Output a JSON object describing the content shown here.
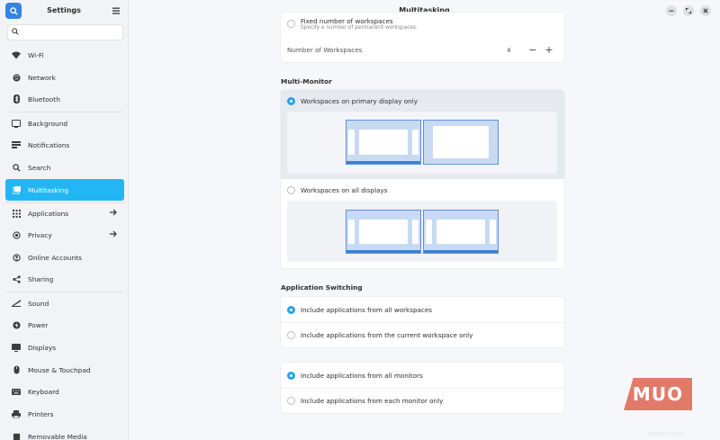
{
  "sidebar": {
    "title": "Settings",
    "search_placeholder": "",
    "items": [
      {
        "label": "Wi-Fi",
        "icon": "wifi-icon"
      },
      {
        "label": "Network",
        "icon": "network-icon"
      },
      {
        "label": "Bluetooth",
        "icon": "bluetooth-icon"
      },
      {
        "label": "Background",
        "icon": "background-icon"
      },
      {
        "label": "Notifications",
        "icon": "notifications-icon"
      },
      {
        "label": "Search",
        "icon": "search-icon"
      },
      {
        "label": "Multitasking",
        "icon": "multitasking-icon",
        "active": true
      },
      {
        "label": "Applications",
        "icon": "applications-icon",
        "arrow": true
      },
      {
        "label": "Privacy",
        "icon": "privacy-icon",
        "arrow": true
      },
      {
        "label": "Online Accounts",
        "icon": "online-accounts-icon"
      },
      {
        "label": "Sharing",
        "icon": "sharing-icon"
      },
      {
        "label": "Sound",
        "icon": "sound-icon"
      },
      {
        "label": "Power",
        "icon": "power-icon"
      },
      {
        "label": "Displays",
        "icon": "displays-icon"
      },
      {
        "label": "Mouse & Touchpad",
        "icon": "mouse-icon"
      },
      {
        "label": "Keyboard",
        "icon": "keyboard-icon"
      },
      {
        "label": "Printers",
        "icon": "printer-icon"
      },
      {
        "label": "Removable Media",
        "icon": "removable-media-icon"
      }
    ]
  },
  "main": {
    "title": "Multitasking",
    "workspaces": {
      "fixed_label": "Fixed number of workspaces",
      "fixed_sub": "Specify a number of permanent workspaces.",
      "count_label": "Number of Workspaces",
      "count_value": "4",
      "minus": "−",
      "plus": "+"
    },
    "multi_monitor": {
      "title": "Multi-Monitor",
      "option_primary": "Workspaces on primary display only",
      "option_all": "Workspaces on all displays",
      "selected": "primary"
    },
    "app_switching": {
      "title": "Application Switching",
      "group1": [
        {
          "label": "Include applications from all workspaces",
          "selected": true
        },
        {
          "label": "Include applications from the current workspace only",
          "selected": false
        }
      ],
      "group2": [
        {
          "label": "Include applications from all monitors",
          "selected": true
        },
        {
          "label": "Include applications from each monitor only",
          "selected": false
        }
      ]
    }
  },
  "watermark": {
    "logo": "MUO",
    "site": "wsxdn.com"
  },
  "colors": {
    "accent": "#22b7f4",
    "radio_selected": "#27a3e8",
    "monitor_bar": "#3b7fd6"
  }
}
